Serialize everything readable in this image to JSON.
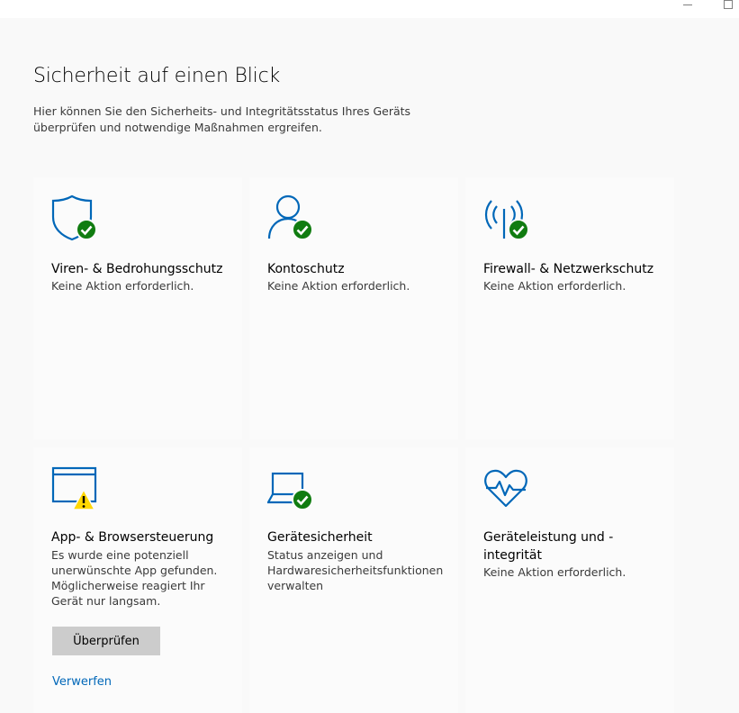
{
  "window": {
    "minimize_icon": "minimize-icon",
    "maximize_icon": "maximize-icon"
  },
  "header": {
    "title": "Sicherheit auf einen Blick",
    "description": "Hier können Sie den Sicherheits- und Integritätsstatus Ihres Geräts überprüfen und notwendige Maßnahmen ergreifen."
  },
  "colors": {
    "accent": "#0067b8",
    "ok": "#107c10",
    "warning": "#ffd700",
    "button": "#cccccc"
  },
  "cards": [
    {
      "title": "Viren- & Bedrohungsschutz",
      "status": "Keine Aktion erforderlich.",
      "icon": "shield-check-icon"
    },
    {
      "title": "Kontoschutz",
      "status": "Keine Aktion erforderlich.",
      "icon": "person-check-icon"
    },
    {
      "title": "Firewall- & Netzwerkschutz",
      "status": "Keine Aktion erforderlich.",
      "icon": "antenna-check-icon"
    },
    {
      "title": "App- & Browsersteuerung",
      "status": "Es wurde eine potenziell unerwünschte App gefunden. Möglicherweise reagiert Ihr Gerät nur langsam.",
      "icon": "browser-warning-icon",
      "action_label": "Überprüfen",
      "dismiss_label": "Verwerfen"
    },
    {
      "title": "Gerätesicherheit",
      "status": "Status anzeigen und Hardwaresicherheitsfunktionen verwalten",
      "icon": "laptop-check-icon"
    },
    {
      "title": "Geräteleistung und -integrität",
      "status": "Keine Aktion erforderlich.",
      "icon": "heart-pulse-icon"
    }
  ]
}
